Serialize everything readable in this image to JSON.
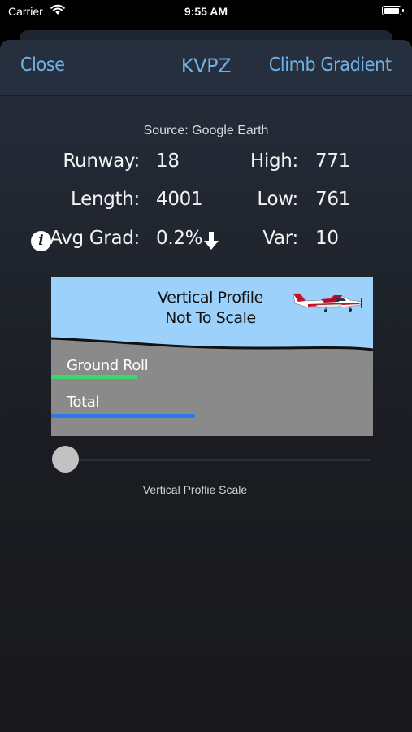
{
  "status_bar": {
    "carrier": "Carrier",
    "time": "9:55 AM",
    "battery_level": 1.0
  },
  "nav": {
    "close_label": "Close",
    "title": "KVPZ",
    "right_label": "Climb Gradient",
    "accent_color": "#6fb0e5"
  },
  "source": "Source: Google Earth",
  "stats": {
    "runway_label": "Runway:",
    "runway_value": "18",
    "high_label": "High:",
    "high_value": "771",
    "length_label": "Length:",
    "length_value": "4001",
    "low_label": "Low:",
    "low_value": "761",
    "avg_grad_label": "Avg Grad:",
    "avg_grad_value": "0.2%",
    "var_label": "Var:",
    "var_value": "10",
    "avg_grad_icon": "arrow-down-icon",
    "info_icon": "info-icon"
  },
  "profile": {
    "title_line1": "Vertical Profile",
    "title_line2": "Not To Scale",
    "ground_roll_label": "Ground Roll",
    "total_label": "Total",
    "ground_roll_fraction": 0.265,
    "total_fraction": 0.448,
    "ground_roll_color": "#3bd96a",
    "total_color": "#3377ef",
    "sky_color": "#9cd1fb",
    "ground_color": "#8a8a8a",
    "aircraft_icon": "airplane-icon"
  },
  "slider": {
    "label": "Vertical Proflie Scale",
    "value": 0.0
  }
}
